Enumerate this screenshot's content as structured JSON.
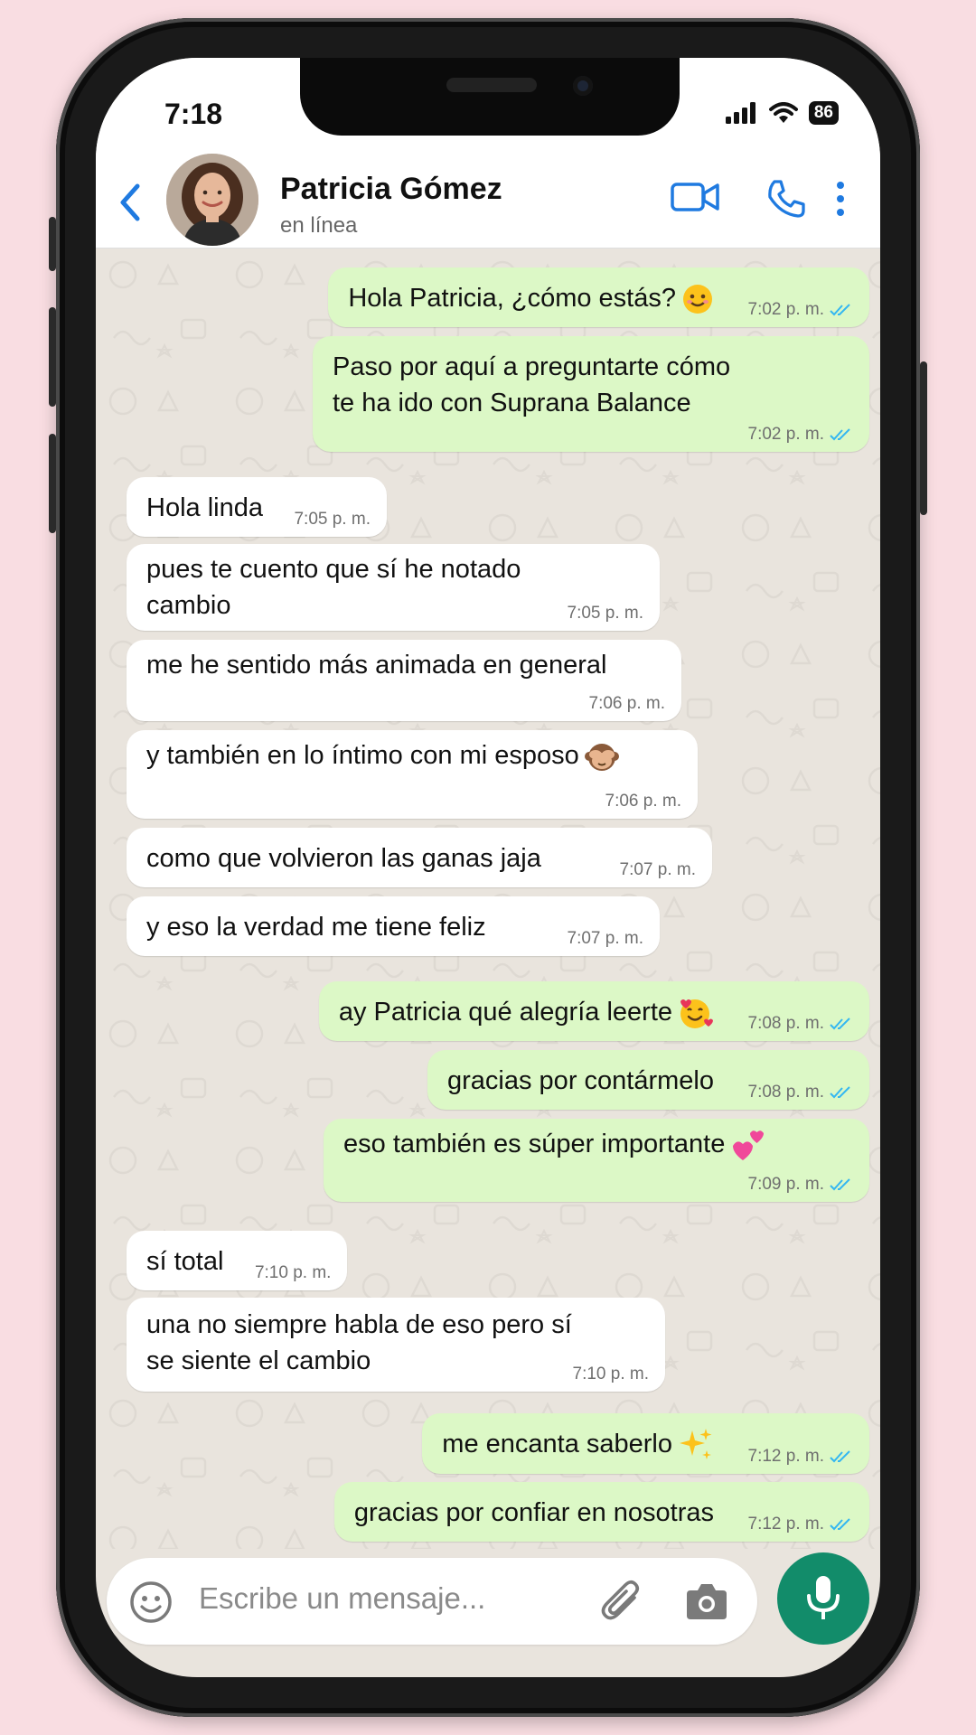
{
  "status_bar": {
    "time": "7:18",
    "battery": "86"
  },
  "header": {
    "contact_name": "Patricia Gómez",
    "contact_status": "en línea"
  },
  "messages": [
    {
      "dir": "out",
      "text": "Hola Patricia, ¿cómo estás?",
      "emoji": "smiling-face",
      "time": "7:02 p. m.",
      "read": true
    },
    {
      "dir": "out",
      "text": "Paso por aquí a preguntarte cómo\nte ha ido con Suprana Balance",
      "time": "7:02 p. m.",
      "read": true
    },
    {
      "dir": "in",
      "text": "Hola linda",
      "time": "7:05 p. m."
    },
    {
      "dir": "in",
      "text": "pues te cuento que sí he notado\ncambio",
      "time": "7:05 p. m."
    },
    {
      "dir": "in",
      "text": "me he sentido más animada en general",
      "time": "7:06 p. m."
    },
    {
      "dir": "in",
      "text": "y también en lo íntimo con mi esposo",
      "emoji": "see-no-evil-monkey",
      "time": "7:06 p. m."
    },
    {
      "dir": "in",
      "text": "como que volvieron las ganas jaja",
      "time": "7:07 p. m."
    },
    {
      "dir": "in",
      "text": "y eso la verdad me tiene feliz",
      "time": "7:07 p. m."
    },
    {
      "dir": "out",
      "text": "ay Patricia qué alegría leerte",
      "emoji": "smiling-face-with-hearts",
      "time": "7:08 p. m.",
      "read": true
    },
    {
      "dir": "out",
      "text": "gracias por contármelo",
      "time": "7:08 p. m.",
      "read": true
    },
    {
      "dir": "out",
      "text": "eso también es súper importante",
      "emoji": "two-hearts",
      "time": "7:09 p. m.",
      "read": true
    },
    {
      "dir": "in",
      "text": "sí total",
      "time": "7:10 p. m."
    },
    {
      "dir": "in",
      "text": "una no siempre habla de eso pero sí\nse siente el cambio",
      "time": "7:10 p. m."
    },
    {
      "dir": "out",
      "text": "me encanta saberlo",
      "emoji": "sparkles",
      "time": "7:12 p. m.",
      "read": true
    },
    {
      "dir": "out",
      "text": "gracias por confiar en nosotras",
      "time": "7:12 p. m.",
      "read": true
    }
  ],
  "input": {
    "placeholder": "Escribe un mensaje..."
  },
  "colors": {
    "accent": "#1f7ae0",
    "outgoing_bubble": "#dcf8c6",
    "incoming_bubble": "#ffffff",
    "read_ticks": "#34b7f1",
    "mic_button": "#128c6a",
    "background": "#f9dde2"
  }
}
